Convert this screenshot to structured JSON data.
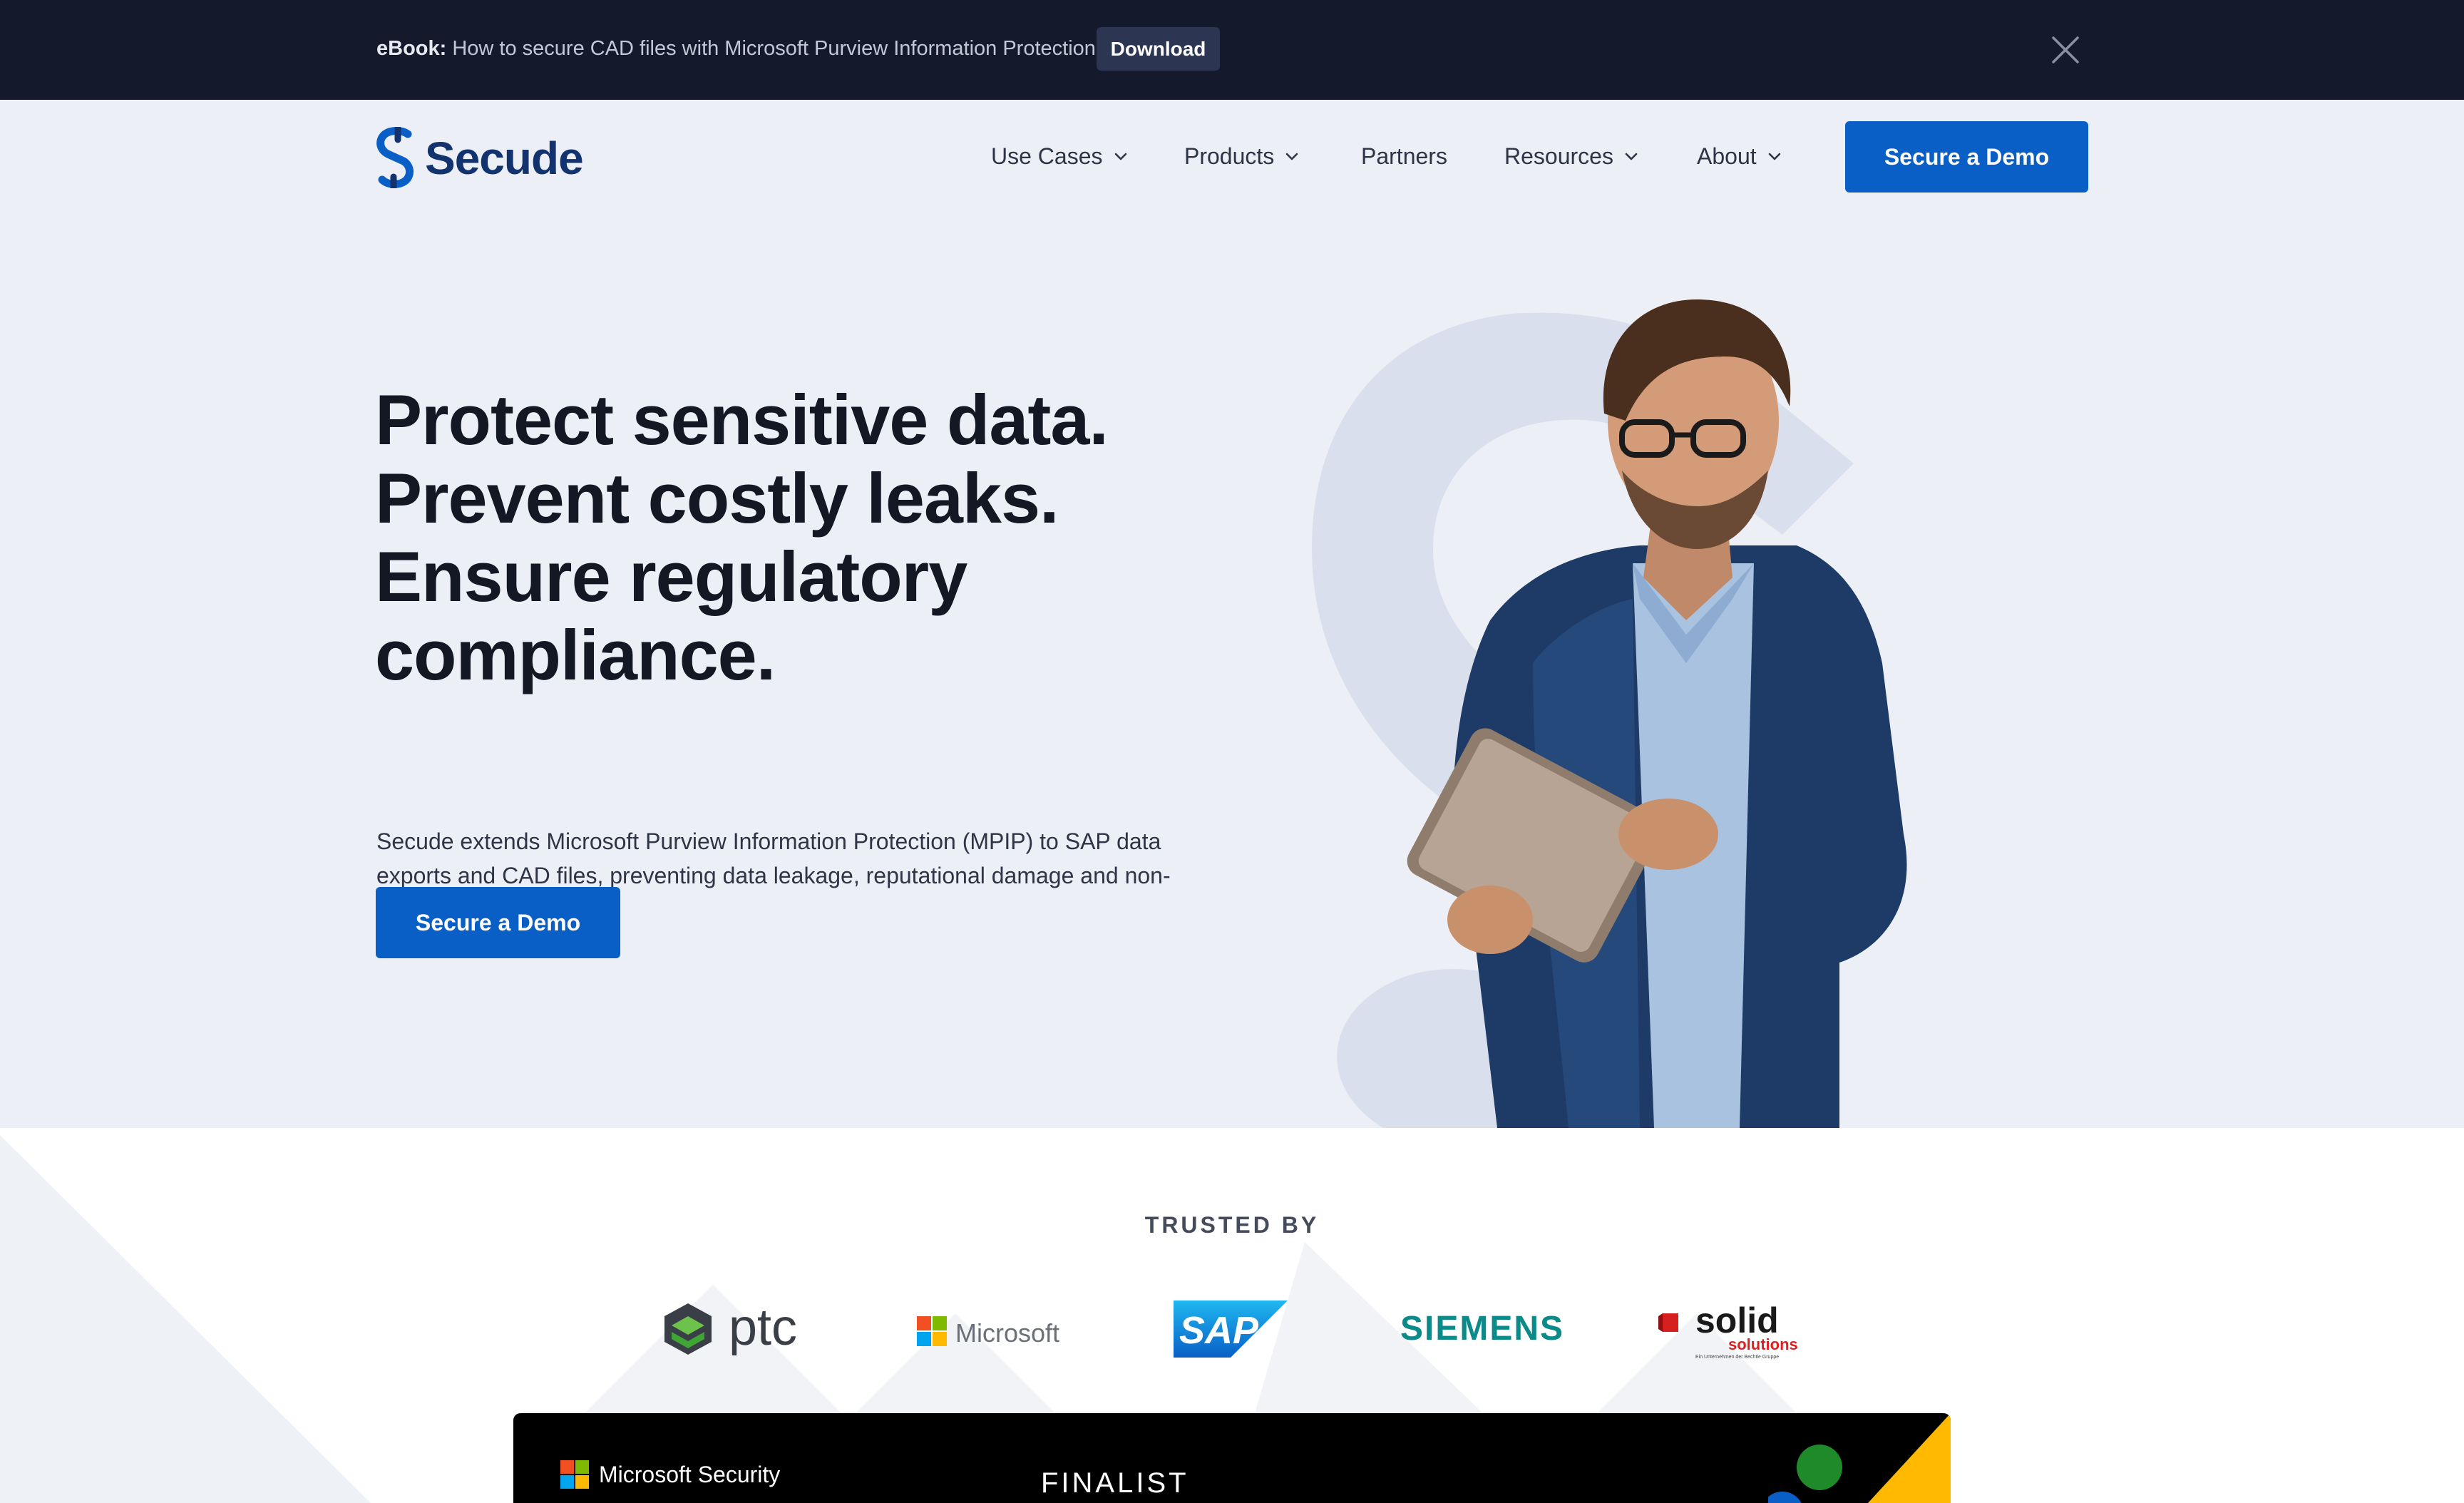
{
  "announcement": {
    "bold": "eBook:",
    "text": " How to secure CAD files with Microsoft Purview Information Protection",
    "button_label": "Download"
  },
  "nav": {
    "logo": "Secude",
    "items": [
      {
        "label": "Use Cases",
        "has_dropdown": true
      },
      {
        "label": "Products",
        "has_dropdown": true
      },
      {
        "label": "Partners",
        "has_dropdown": false
      },
      {
        "label": "Resources",
        "has_dropdown": true
      },
      {
        "label": "About",
        "has_dropdown": true
      }
    ],
    "cta_label": "Secure a Demo"
  },
  "hero": {
    "title_lines": [
      "Protect sensitive data.",
      "Prevent costly leaks.",
      "Ensure regulatory",
      "compliance."
    ],
    "description": "Secude extends Microsoft Purview Information Protection (MPIP) to SAP data exports and CAD files, preventing data leakage, reputational damage and non-compliance.",
    "cta_label": "Secure a Demo"
  },
  "trusted": {
    "label": "TRUSTED BY",
    "logos": {
      "ptc": "ptc",
      "microsoft": "Microsoft",
      "sap": "SAP",
      "siemens": "SIEMENS",
      "solid": "solid",
      "solid_sub": "solutions",
      "solid_tiny": "Ein Unternehmen der Bechtle Gruppe"
    }
  },
  "award": {
    "brand": "Microsoft Security",
    "badge": "FINALIST"
  },
  "colors": {
    "accent": "#0a5fc7",
    "topbar_bg": "#141a2b",
    "hero_bg": "#eceff5",
    "brand_navy": "#12336e"
  }
}
